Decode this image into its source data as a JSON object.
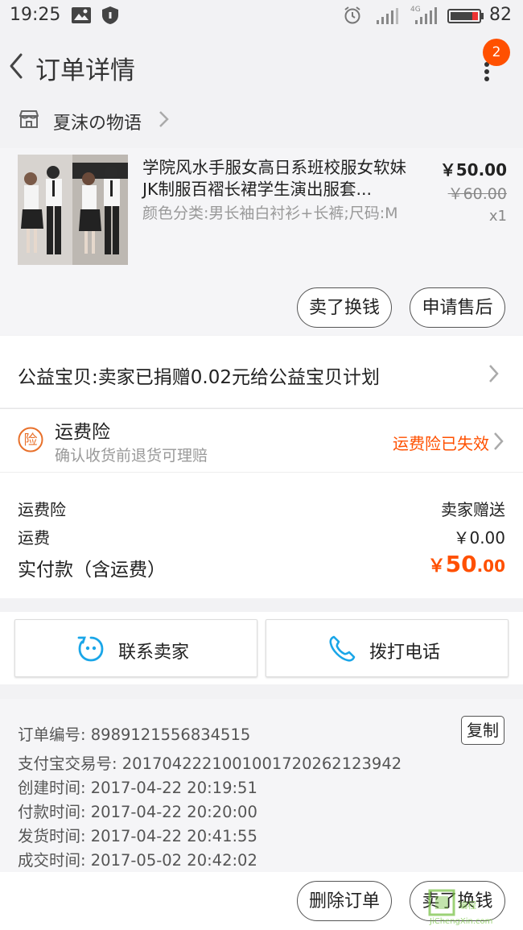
{
  "status_bar": {
    "time": "19:25",
    "battery": "82"
  },
  "header": {
    "title": "订单详情",
    "badge_count": "2"
  },
  "shop": {
    "name": "夏沫の物语"
  },
  "product": {
    "title": "学院风水手服女高日系班校服女软妹JK制服百褶长裙学生演出服套...",
    "sku": "颜色分类:男长袖白衬衫+长裤;尺码:M",
    "price": "￥50.00",
    "original_price": "￥60.00",
    "quantity": "x1",
    "actions": [
      "卖了换钱",
      "申请售后"
    ]
  },
  "charity": {
    "text": "公益宝贝:卖家已捐赠0.02元给公益宝贝计划"
  },
  "insurance": {
    "icon_char": "险",
    "title": "运费险",
    "subtitle": "确认收货前退货可理赔",
    "status": "运费险已失效"
  },
  "fees": {
    "rows": [
      {
        "label": "运费险",
        "value": "卖家赠送"
      },
      {
        "label": "运费",
        "value": "￥0.00"
      }
    ],
    "total_label": "实付款（含运费）",
    "total_currency": "￥",
    "total_main": "50",
    "total_decimal": ".00"
  },
  "contact": {
    "seller": "联系卖家",
    "call": "拨打电话"
  },
  "order_info": {
    "copy_label": "复制",
    "lines": [
      "订单编号: 8989121556834515",
      "支付宝交易号: 2017042221001001720262123942",
      "创建时间: 2017-04-22 20:19:51",
      "付款时间: 2017-04-22 20:20:00",
      "发货时间: 2017-04-22 20:41:55",
      "成交时间: 2017-05-02 20:42:02"
    ]
  },
  "bottom": {
    "actions": [
      "删除订单",
      "卖了换钱"
    ]
  },
  "watermark": {
    "text": "JiChengXin.com"
  },
  "colors": {
    "accent": "#ff5000",
    "contact_icon": "#1aa6e8"
  },
  "icons": [
    "back-arrow-icon",
    "more-vertical-icon",
    "shop-icon",
    "chevron-right-icon",
    "insurance-icon",
    "chat-face-icon",
    "phone-icon",
    "signal-icon",
    "battery-icon",
    "alarm-icon"
  ]
}
